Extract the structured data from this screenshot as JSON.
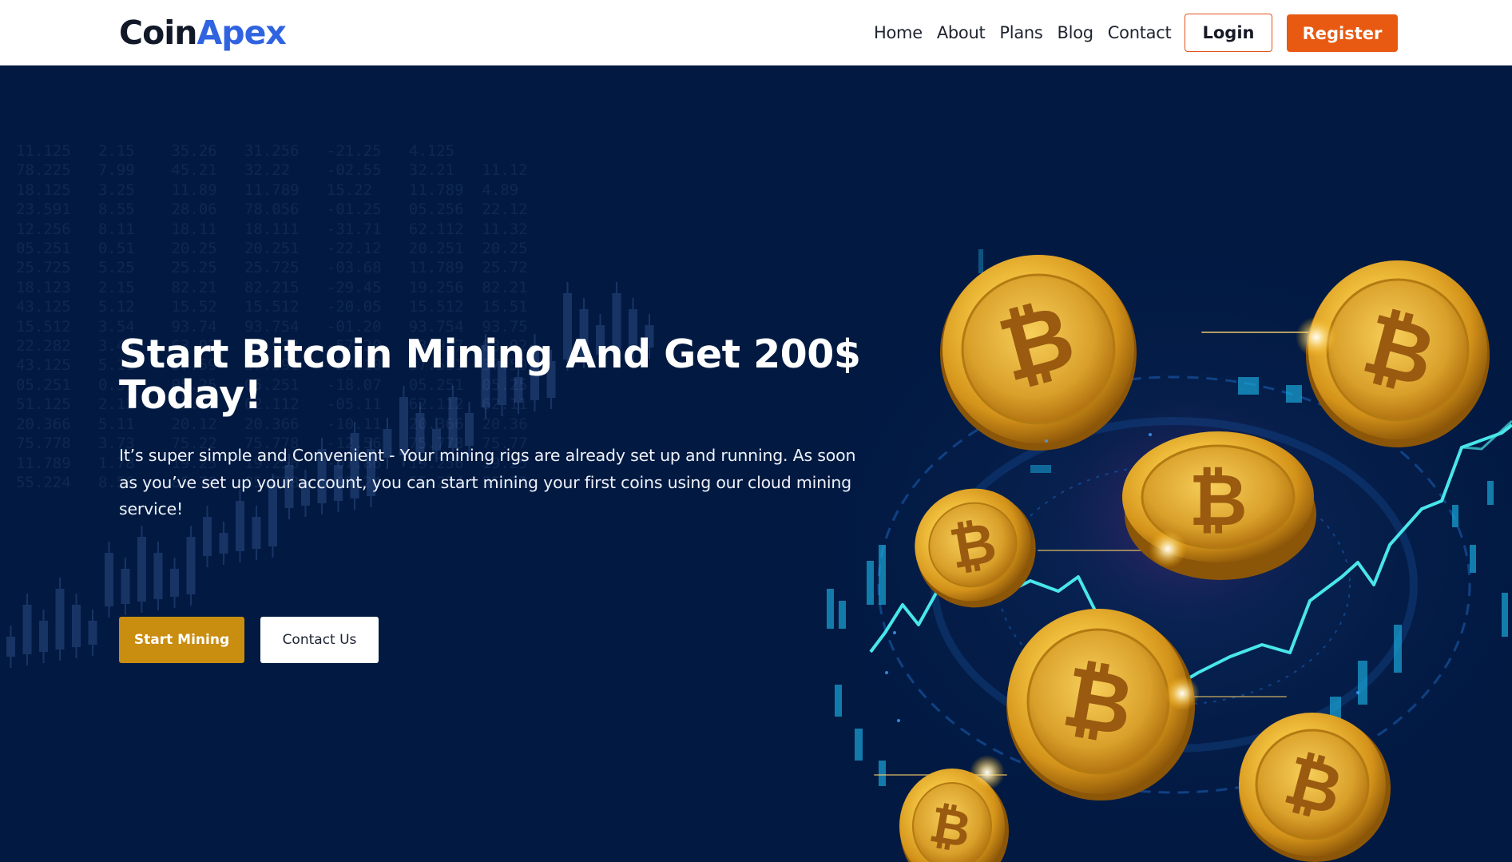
{
  "brand": {
    "part1": "Coin",
    "part2": "Apex"
  },
  "nav": {
    "items": [
      "Home",
      "About",
      "Plans",
      "Blog",
      "Contact"
    ],
    "login_label": "Login",
    "register_label": "Register"
  },
  "hero": {
    "title": "Start Bitcoin Mining And Get 200$ Today!",
    "description": "It’s super simple and Convenient - Your mining rigs are already set up and running. As soon as you’ve set up your account, you can start mining your first coins using our cloud mining service!",
    "primary_cta": "Start Mining",
    "secondary_cta": "Contact Us"
  },
  "colors": {
    "brand_dark": "#111827",
    "brand_accent": "#2f63e0",
    "register": "#e85a12",
    "hero_bg": "#021a42",
    "cta_gold": "#c98d0f"
  },
  "icons": {
    "coin": "bitcoin-coin-icon"
  }
}
